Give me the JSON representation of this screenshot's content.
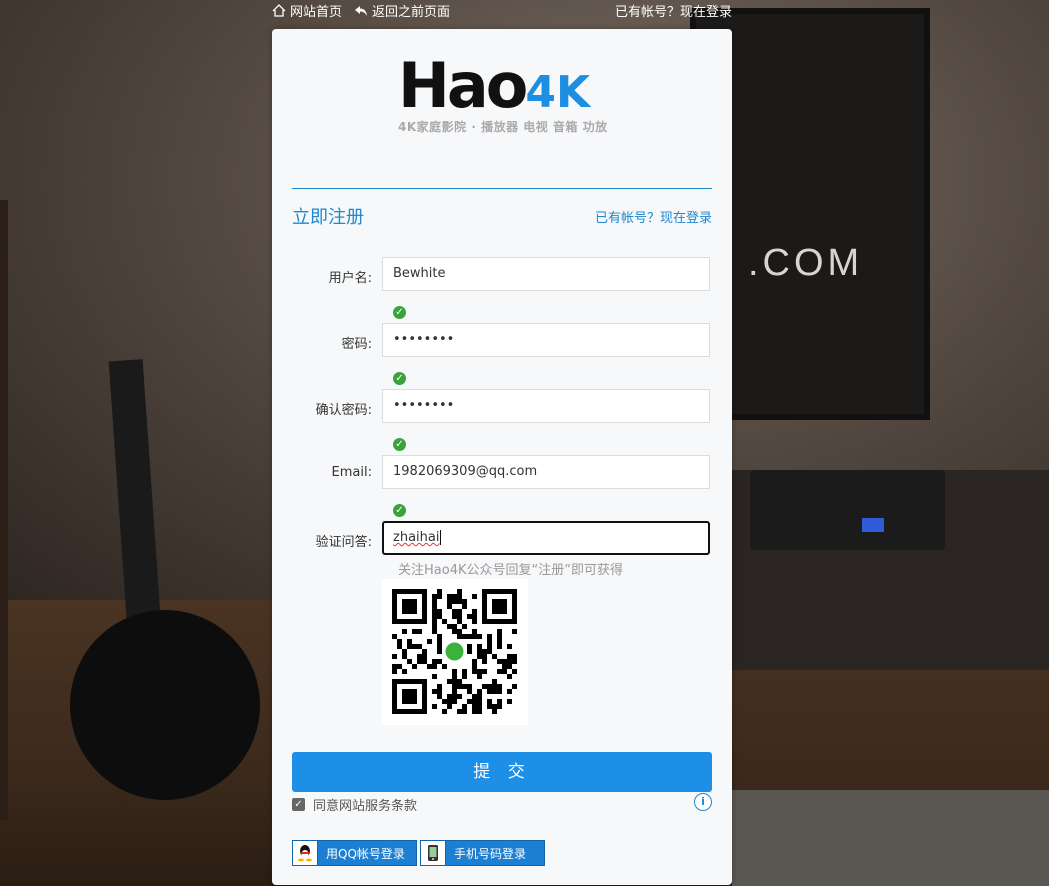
{
  "topbar": {
    "home_label": "网站首页",
    "back_label": "返回之前页面",
    "login_label": "已有帐号？现在登录"
  },
  "brand": {
    "logo_text": "Hao",
    "logo_suffix": "4K",
    "tagline": "4K家庭影院 · 播放器 电视 音箱 功放",
    "accent_color": "#1e8fe0"
  },
  "background": {
    "poster_text": ".COM"
  },
  "form": {
    "title": "立即注册",
    "have_account_link": "已有帐号？现在登录",
    "fields": [
      {
        "label": "用户名:",
        "value": "Bewhite",
        "valid": true
      },
      {
        "label": "密码:",
        "value": "••••••••",
        "valid": true
      },
      {
        "label": "确认密码:",
        "value": "••••••••",
        "valid": true
      },
      {
        "label": "Email:",
        "value": "1982069309@qq.com",
        "valid": true
      },
      {
        "label": "验证问答:",
        "value": "zhaihai",
        "focused": true
      }
    ],
    "hint": "关注Hao4K公众号回复“注册”即可获得",
    "submit_label": "提 交",
    "agree_label": "同意网站服务条款",
    "agree_checked": true
  },
  "social": {
    "qq_label": "用QQ帐号登录",
    "phone_label": "手机号码登录"
  }
}
